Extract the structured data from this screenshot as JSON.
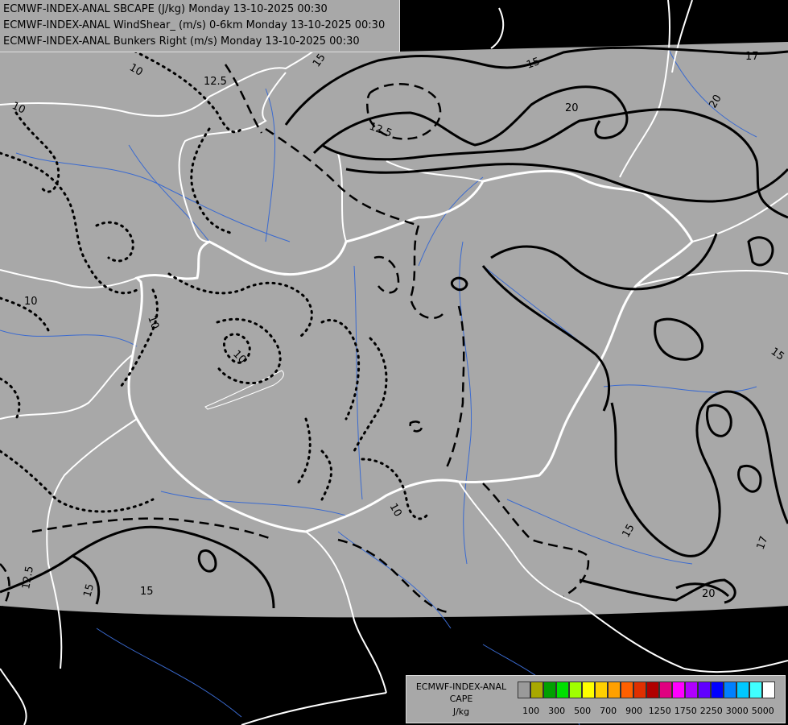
{
  "title_lines": [
    "ECMWF-INDEX-ANAL SBCAPE (J/kg) Monday 13-10-2025 00:30",
    "ECMWF-INDEX-ANAL WindShear_ (m/s) 0-6km Monday 13-10-2025 00:30",
    "ECMWF-INDEX-ANAL Bunkers Right (m/s) Monday 13-10-2025 00:30"
  ],
  "legend": {
    "source": "ECMWF-INDEX-ANAL",
    "variable": "CAPE",
    "unit": "J/kg",
    "colors": [
      "#9a9a9a",
      "#a8a800",
      "#00a000",
      "#00e000",
      "#a0ff00",
      "#ffff00",
      "#ffd000",
      "#ffa000",
      "#ff6000",
      "#e03000",
      "#b00000",
      "#e00080",
      "#ff00ff",
      "#b000ff",
      "#6000ff",
      "#0000ff",
      "#0080ff",
      "#00c8ff",
      "#40ffff",
      "#ffffff"
    ],
    "ticks": [
      "100",
      "300",
      "500",
      "700",
      "900",
      "1250",
      "1750",
      "2250",
      "3000",
      "5000"
    ]
  },
  "contour_labels": [
    {
      "text": "15"
    },
    {
      "text": "15"
    },
    {
      "text": "17"
    },
    {
      "text": "20"
    },
    {
      "text": "20"
    },
    {
      "text": "12.5"
    },
    {
      "text": "12.5"
    },
    {
      "text": "10"
    },
    {
      "text": "10"
    },
    {
      "text": "10"
    },
    {
      "text": "10"
    },
    {
      "text": "10"
    },
    {
      "text": "10"
    },
    {
      "text": "15"
    },
    {
      "text": "15"
    },
    {
      "text": "17"
    },
    {
      "text": "20"
    },
    {
      "text": "15"
    },
    {
      "text": "15"
    },
    {
      "text": "12.5"
    }
  ],
  "colors": {
    "background": "#000000",
    "data_area": "#a8a8a8",
    "borders": "#ffffff",
    "rivers": "#3a6ad0",
    "contours": "#000000"
  }
}
